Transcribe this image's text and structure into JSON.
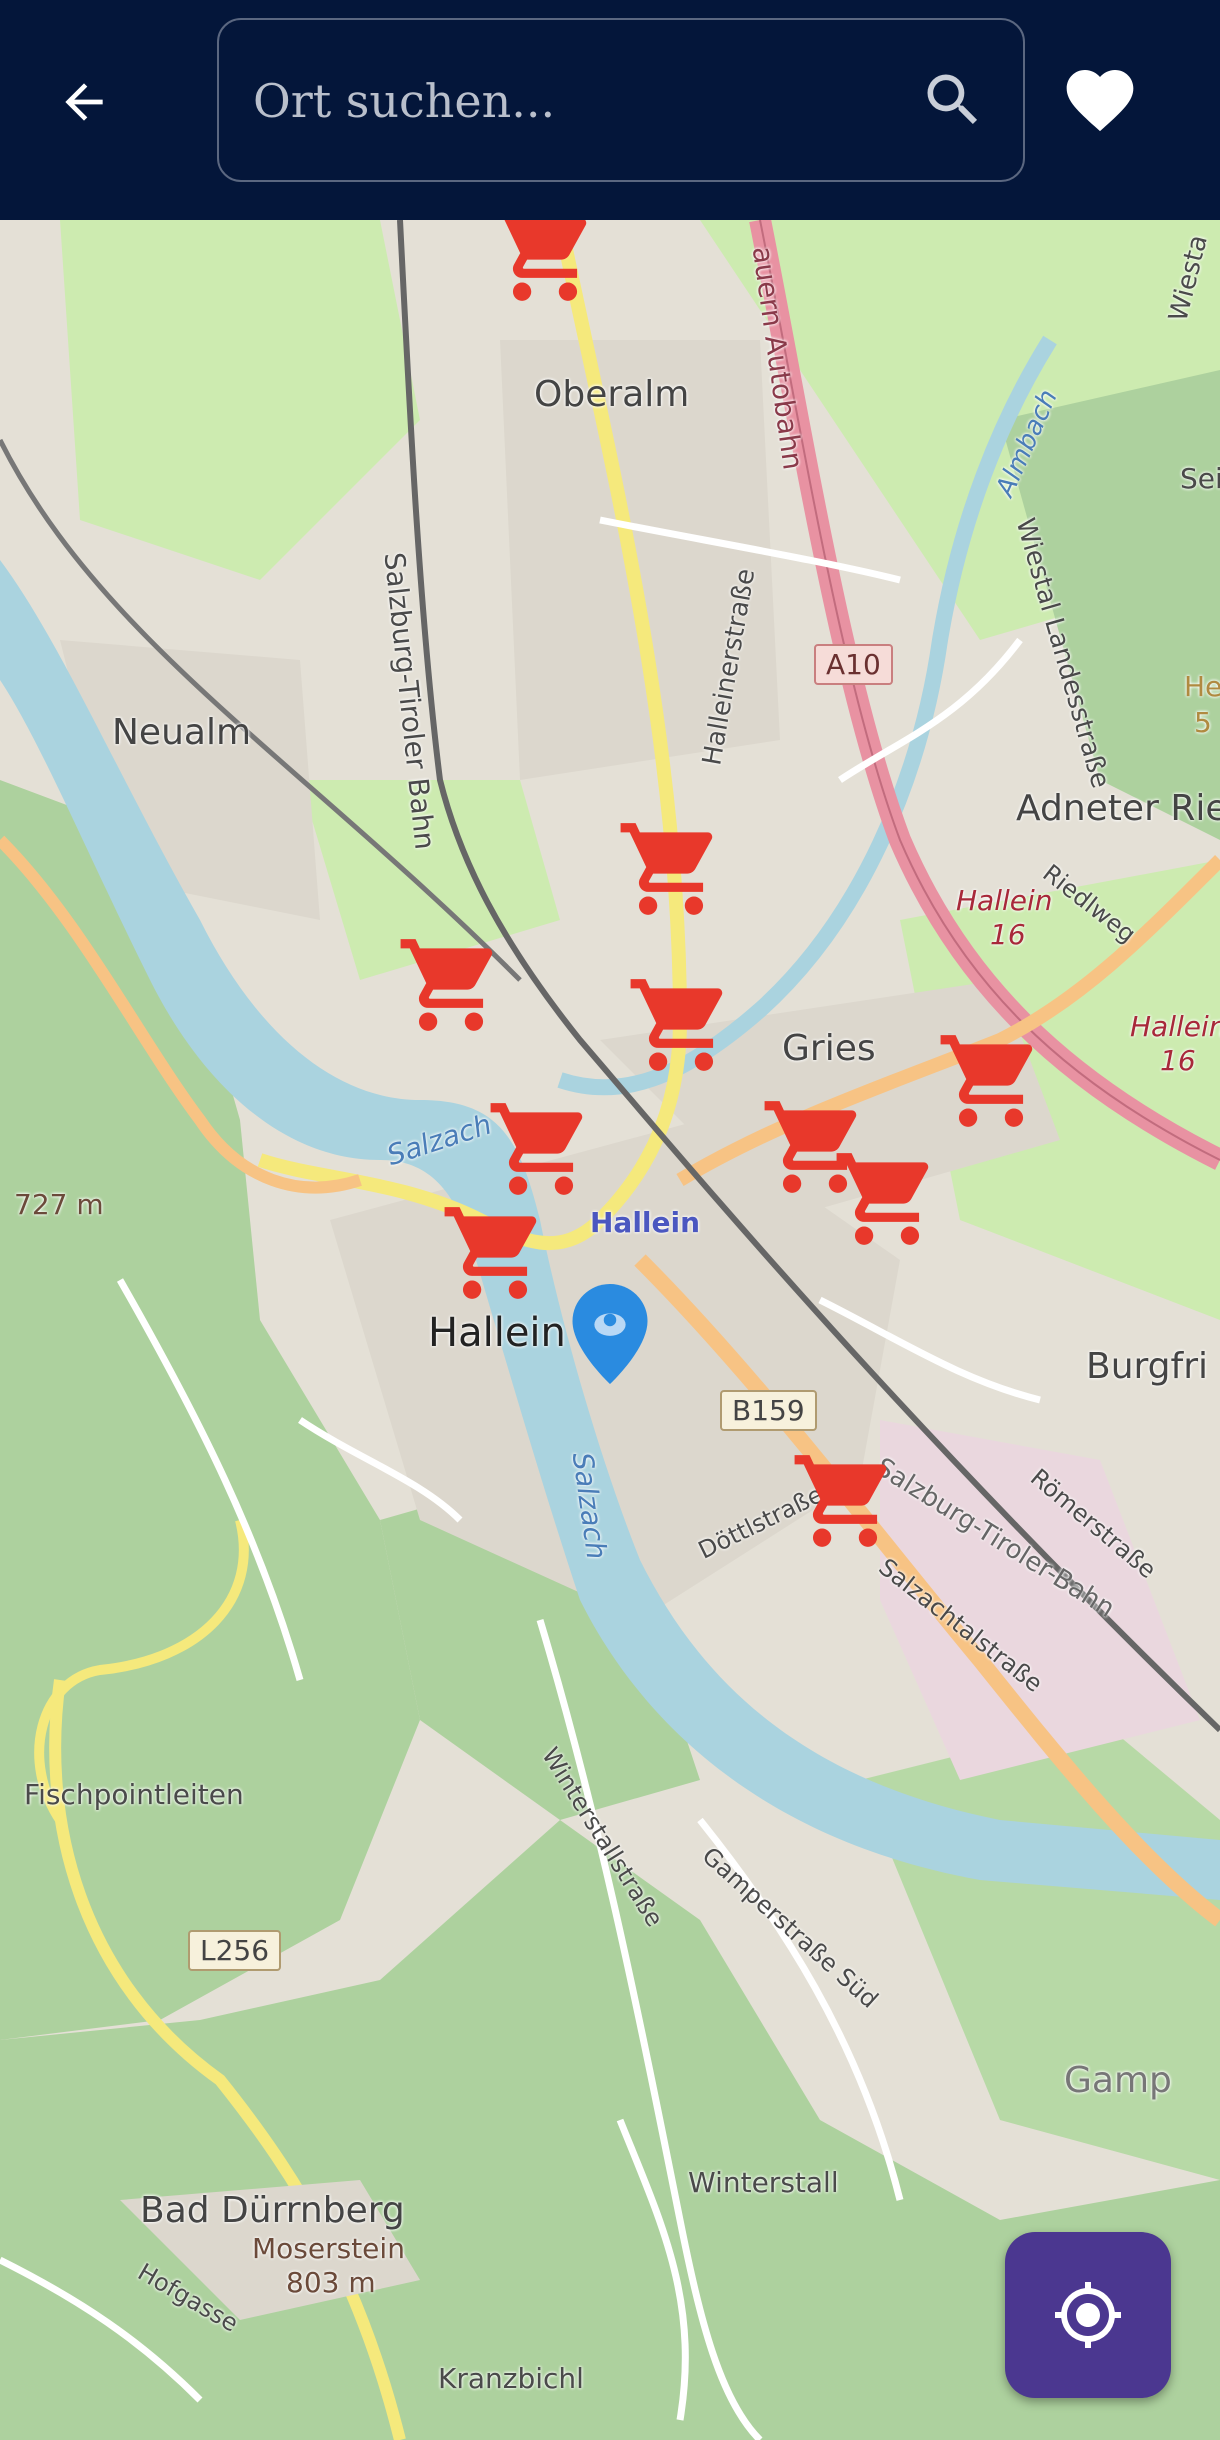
{
  "header": {
    "back_icon": "arrow-left-icon",
    "search_placeholder": "Ort suchen...",
    "search_value": "",
    "search_icon": "search-icon",
    "favorites_icon": "heart-icon"
  },
  "map": {
    "places": {
      "oberalm": "Oberalm",
      "neualm": "Neualm",
      "gries": "Gries",
      "hallein_station": "Hallein",
      "hallein": "Hallein",
      "burgfried": "Burgfri",
      "adneter": "Adneter Rie",
      "fischpointleiten": "Fischpointleiten",
      "bad_duerrnberg": "Bad Dürrnberg",
      "moserstein": "Moserstein",
      "moserstein_elev": "803 m",
      "peak_727": "727 m",
      "winterstall": "Winterstall",
      "kranzbichl": "Kranzbichl",
      "gamp": "Gamp",
      "sei": "Sei",
      "he": "He",
      "he5": "5"
    },
    "streets": {
      "autobahn": "auern Autobahn",
      "salzburg_tiroler_bahn": "Salzburg-Tiroler Bahn",
      "halleiner_strasse": "Halleinerstraße",
      "wiestal_landesstrasse": "Wiestal Landesstraße",
      "wiesta": "Wiesta",
      "almbach": "Almbach",
      "riedlweg": "Riedlweg",
      "hallein16a": "Hallein",
      "hallein16a_num": "16",
      "hallein16b": "Hallein",
      "hallein16b_num": "16",
      "salzach_north": "Salzach",
      "salzach_south": "Salzach",
      "doettlstrasse": "Döttlstraße",
      "salzburg_tiroler_bahn_2": "Salzburg-Tiroler-Bahn",
      "salzachtalstrasse": "Salzachtalstraße",
      "roemerstrasse": "Römerstraße",
      "winterstallstrasse": "Winterstallstraße",
      "gamperstrasse": "Gamperstraße Süd",
      "hofgasse": "Hofgasse"
    },
    "shields": {
      "a10": "A10",
      "b159": "B159",
      "l256": "L256"
    },
    "marker_icon": "shopping-cart-icon",
    "location_pin_icon": "location-pin-icon",
    "colors": {
      "marker": "#e8382b",
      "pin": "#2a8be0",
      "header": "#04163a",
      "locate_button": "#4b3790",
      "river": "#aad3df",
      "forest": "#add19e",
      "autobahn": "#e892a2"
    }
  },
  "locate_button": {
    "icon": "my-location-icon"
  }
}
